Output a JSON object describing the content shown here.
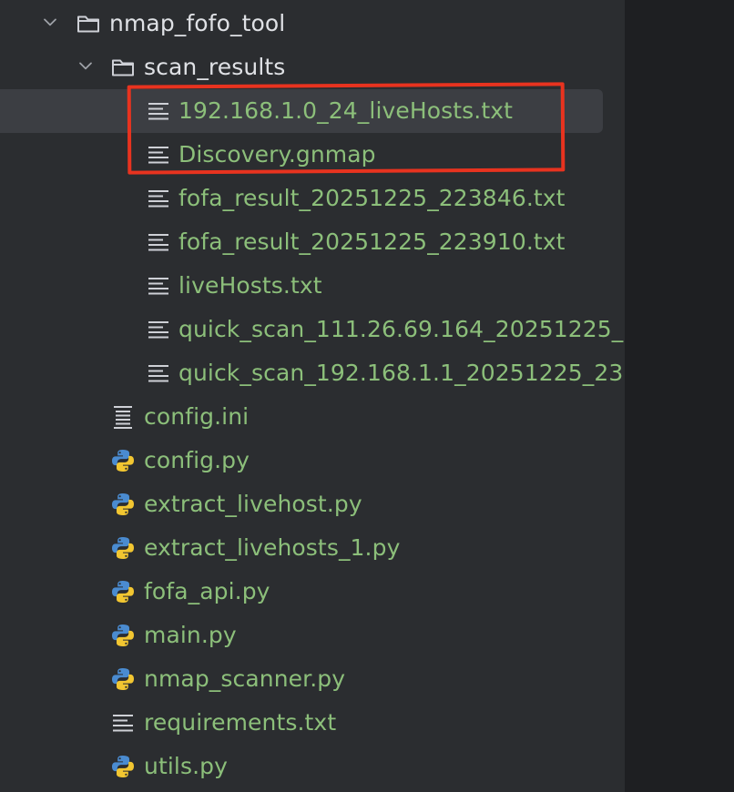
{
  "tree": {
    "root_folder": "nmap_fofo_tool",
    "subfolder": "scan_results",
    "scan_results_files": [
      "192.168.1.0_24_liveHosts.txt",
      "Discovery.gnmap",
      "fofa_result_20251225_223846.txt",
      "fofa_result_20251225_223910.txt",
      "liveHosts.txt",
      "quick_scan_111.26.69.164_20251225_",
      "quick_scan_192.168.1.1_20251225_23"
    ],
    "root_files": [
      {
        "name": "config.ini",
        "icon": "config-file-icon"
      },
      {
        "name": "config.py",
        "icon": "python-icon"
      },
      {
        "name": "extract_livehost.py",
        "icon": "python-icon"
      },
      {
        "name": "extract_livehosts_1.py",
        "icon": "python-icon"
      },
      {
        "name": "fofa_api.py",
        "icon": "python-icon"
      },
      {
        "name": "main.py",
        "icon": "python-icon"
      },
      {
        "name": "nmap_scanner.py",
        "icon": "python-icon"
      },
      {
        "name": "requirements.txt",
        "icon": "text-file-icon"
      },
      {
        "name": "utils.py",
        "icon": "python-icon"
      }
    ]
  },
  "colors": {
    "background": "#2b2d30",
    "editor_background": "#1e1f22",
    "selection": "#3c3e43",
    "folder_text": "#dfe1e5",
    "file_text": "#8cbf7a",
    "annotation_box": "#e8331f"
  }
}
